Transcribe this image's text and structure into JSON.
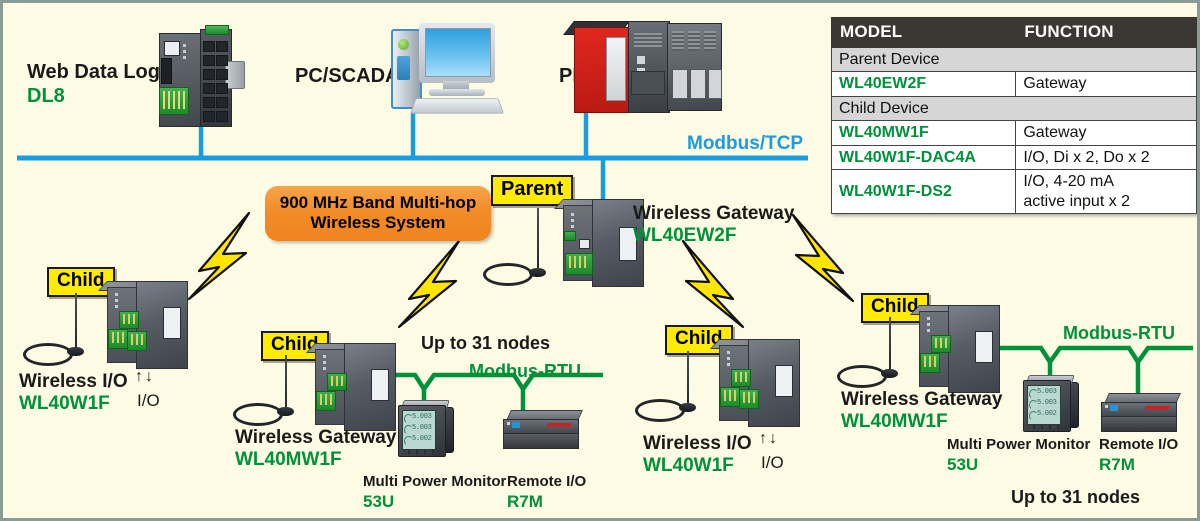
{
  "diagram": {
    "title": "900 MHz Band Multi-hop Wireless System",
    "colors": {
      "background": "#fdfbe3",
      "green": "#00913a",
      "blue": "#1a9de0",
      "yellow_tag": "#ffec00",
      "orange_pill": "#f28c28",
      "table_header": "#3b3733"
    }
  },
  "pill": {
    "line1": "900 MHz Band Multi-hop",
    "line2": "Wireless System"
  },
  "network": {
    "tcp_label": "Modbus/TCP",
    "rtu_label": "Modbus-RTU",
    "nodes_label": "Up to 31 nodes"
  },
  "tags": {
    "parent": "Parent",
    "child": "Child"
  },
  "top_devices": [
    {
      "name": "Web Data Logger",
      "model": "DL8",
      "icon": "data-logger-icon"
    },
    {
      "name": "PC/SCADA",
      "model": "",
      "icon": "pc-scada-icon"
    },
    {
      "name": "PLC",
      "model": "",
      "icon": "plc-icon"
    }
  ],
  "parent_node": {
    "tag": "Parent",
    "name": "Wireless Gateway",
    "model": "WL40EW2F"
  },
  "children": [
    {
      "tag": "Child",
      "name": "Wireless I/O",
      "model": "WL40W1F",
      "io_label": "I/O",
      "io_arrows": "↑↓"
    },
    {
      "tag": "Child",
      "name": "Wireless Gateway",
      "model": "WL40MW1F",
      "bus": "Modbus-RTU",
      "nodes": "Up to 31 nodes",
      "peripherals": [
        {
          "name": "Multi Power Monitor",
          "model": "53U",
          "display": [
            "5.003",
            "5.003",
            "5.002"
          ]
        },
        {
          "name": "Remote I/O",
          "model": "R7M"
        }
      ]
    },
    {
      "tag": "Child",
      "name": "Wireless I/O",
      "model": "WL40W1F",
      "io_label": "I/O",
      "io_arrows": "↑↓"
    },
    {
      "tag": "Child",
      "name": "Wireless Gateway",
      "model": "WL40MW1F",
      "bus": "Modbus-RTU",
      "nodes": "Up to 31 nodes",
      "peripherals": [
        {
          "name": "Multi Power Monitor",
          "model": "53U",
          "display": [
            "5.003",
            "5.003",
            "5.002"
          ]
        },
        {
          "name": "Remote I/O",
          "model": "R7M"
        }
      ]
    }
  ],
  "table": {
    "headers": [
      "MODEL",
      "FUNCTION"
    ],
    "rows": [
      {
        "type": "section",
        "label": "Parent Device"
      },
      {
        "type": "data",
        "model": "WL40EW2F",
        "function": "Gateway"
      },
      {
        "type": "section",
        "label": "Child Device"
      },
      {
        "type": "data",
        "model": "WL40MW1F",
        "function": "Gateway"
      },
      {
        "type": "data",
        "model": "WL40W1F-DAC4A",
        "function": "I/O, Di x 2, Do x 2"
      },
      {
        "type": "data",
        "model": "WL40W1F-DS2",
        "function": "I/O, 4-20 mA\nactive input x 2"
      }
    ]
  }
}
